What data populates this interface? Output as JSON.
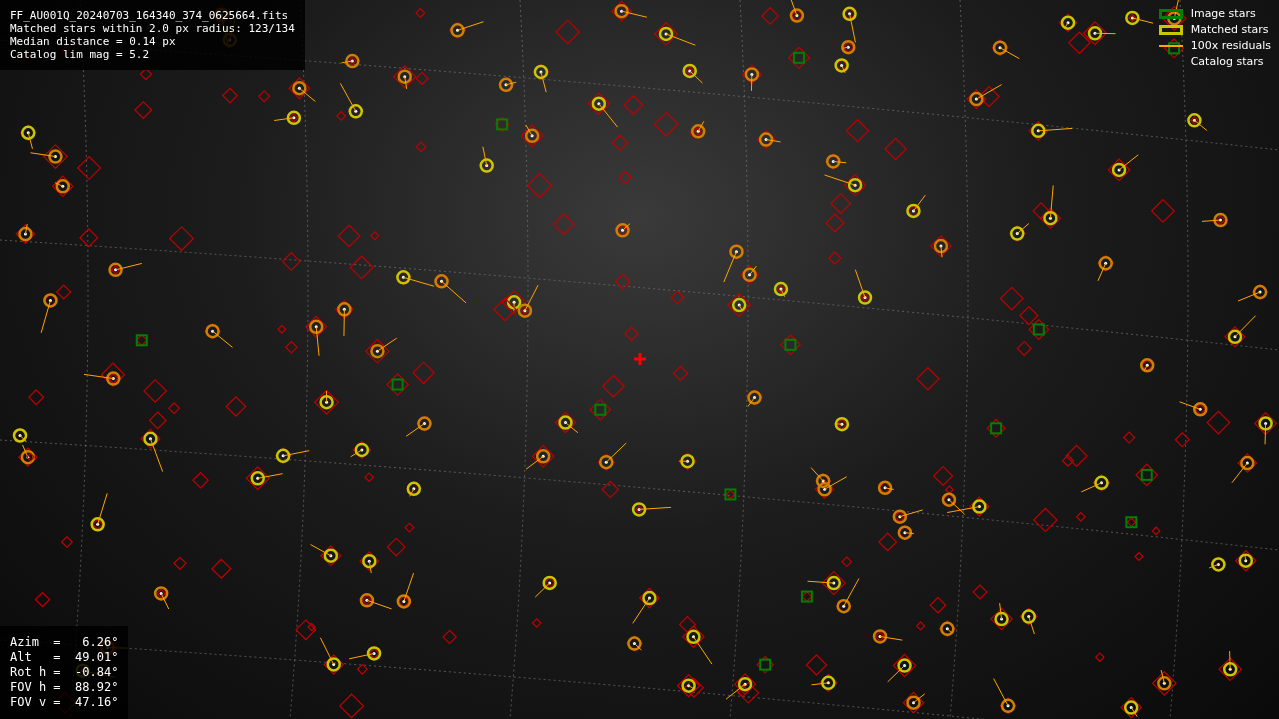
{
  "info": {
    "lines": [
      "FF_AU001Q_20240703_164340_374_0625664.fits",
      "Matched stars within 2.0 px radius: 123/134",
      "Median distance = 0.14 px",
      "Catalog lim mag = 5.2"
    ]
  },
  "pointing": {
    "lines": [
      "Azim  =   6.26°",
      "Alt   =  49.01°",
      "Rot h =  -0.84°",
      "FOV h =  88.92°",
      "FOV v =  47.16°"
    ]
  },
  "legend": [
    {
      "label": "Image stars",
      "kind": "box",
      "color": "#008000"
    },
    {
      "label": "Matched stars",
      "kind": "box",
      "color": "#c8c800"
    },
    {
      "label": "100x residuals",
      "kind": "line",
      "color": "#ffa500"
    },
    {
      "label": "Catalog stars",
      "kind": "none"
    }
  ]
}
